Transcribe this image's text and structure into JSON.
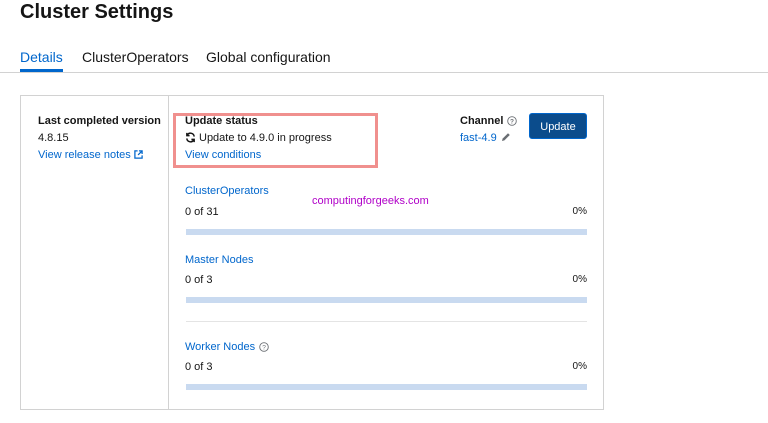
{
  "page": {
    "title": "Cluster Settings"
  },
  "tabs": [
    {
      "label": "Details",
      "active": true
    },
    {
      "label": "ClusterOperators",
      "active": false
    },
    {
      "label": "Global configuration",
      "active": false
    }
  ],
  "version": {
    "label": "Last completed version",
    "value": "4.8.15",
    "release_notes_link": "View release notes"
  },
  "update_status": {
    "label": "Update status",
    "status_text": "Update to 4.9.0 in progress",
    "conditions_link": "View conditions"
  },
  "channel": {
    "label": "Channel",
    "value": "fast-4.9"
  },
  "update_button": {
    "label": "Update"
  },
  "progress": [
    {
      "name": "ClusterOperators",
      "count": "0 of 31",
      "percent": "0%",
      "fraction": 0
    },
    {
      "name": "Master Nodes",
      "count": "0 of 3",
      "percent": "0%",
      "fraction": 0
    },
    {
      "name": "Worker Nodes",
      "count": "0 of 3",
      "percent": "0%",
      "fraction": 0
    }
  ],
  "watermark": "computingforgeeks.com",
  "colors": {
    "accent": "#0066cc",
    "button": "#0b4c8c",
    "highlight": "#f0908e",
    "bar": "#c9daf0"
  },
  "icons": [
    "sync-icon",
    "external-link-icon",
    "help-icon",
    "pencil-icon"
  ]
}
